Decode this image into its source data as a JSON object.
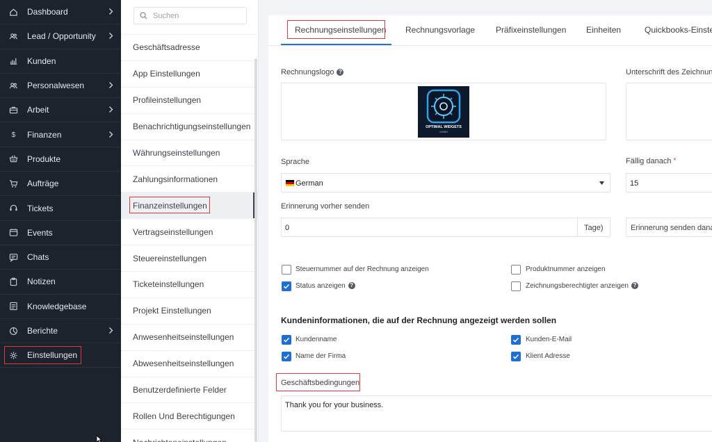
{
  "sidebar": {
    "items": [
      {
        "label": "Dashboard",
        "icon": "home-icon",
        "chevron": true
      },
      {
        "label": "Lead / Opportunity",
        "icon": "users-icon",
        "chevron": true
      },
      {
        "label": "Kunden",
        "icon": "chart-icon",
        "chevron": false
      },
      {
        "label": "Personalwesen",
        "icon": "people-icon",
        "chevron": true
      },
      {
        "label": "Arbeit",
        "icon": "briefcase-icon",
        "chevron": true
      },
      {
        "label": "Finanzen",
        "icon": "dollar-icon",
        "chevron": true
      },
      {
        "label": "Produkte",
        "icon": "basket-icon",
        "chevron": false
      },
      {
        "label": "Aufträge",
        "icon": "cart-icon",
        "chevron": false
      },
      {
        "label": "Tickets",
        "icon": "headset-icon",
        "chevron": false
      },
      {
        "label": "Events",
        "icon": "calendar-icon",
        "chevron": false
      },
      {
        "label": "Chats",
        "icon": "chat-icon",
        "chevron": false
      },
      {
        "label": "Notizen",
        "icon": "clipboard-icon",
        "chevron": false
      },
      {
        "label": "Knowledgebase",
        "icon": "document-icon",
        "chevron": false
      },
      {
        "label": "Berichte",
        "icon": "pie-icon",
        "chevron": true
      },
      {
        "label": "Einstellungen",
        "icon": "gear-icon",
        "chevron": false
      }
    ]
  },
  "submenu": {
    "search_placeholder": "Suchen",
    "items": [
      "Geschäftsadresse",
      "App Einstellungen",
      "Profileinstellungen",
      "Benachrichtigungseinstellungen",
      "Währungseinstellungen",
      "Zahlungsinformationen",
      "Finanzeinstellungen",
      "Vertragseinstellungen",
      "Steuereinstellungen",
      "Ticketeinstellungen",
      "Projekt Einstellungen",
      "Anwesenheitseinstellungen",
      "Abwesenheitseinstellungen",
      "Benutzerdefinierte Felder",
      "Rollen Und Berechtigungen",
      "Nachrichteneinstellungen"
    ],
    "active_index": 6
  },
  "tabs": [
    "Rechnungseinstellungen",
    "Rechnungsvorlage",
    "Präfixeinstellungen",
    "Einheiten",
    "Quickbooks-Einstell"
  ],
  "form": {
    "logo_label": "Rechnungslogo",
    "signature_label": "Unterschrift des Zeichnung",
    "logo_text": "OPTIMAL WIDGETS",
    "logo_subtext": "GMBH",
    "language_label": "Sprache",
    "language_value": "German",
    "due_label": "Fällig danach",
    "due_required": "*",
    "due_value": "15",
    "reminder_label": "Erinnerung vorher senden",
    "reminder_value": "0",
    "reminder_unit": "Tage)",
    "reminder_after_value": "Erinnerung senden danac",
    "checkboxes": [
      {
        "label": "Steuernummer auf der Rechnung anzeigen",
        "checked": false
      },
      {
        "label": "Produktnummer anzeigen",
        "checked": false
      },
      {
        "label": "Status anzeigen",
        "checked": true
      },
      {
        "label": "Zeichnungsberechtigter anzeigen",
        "checked": false
      }
    ],
    "customer_section_title": "Kundeninformationen, die auf der Rechnung angezeigt werden sollen",
    "customer_checkboxes": [
      {
        "label": "Kundenname",
        "checked": true
      },
      {
        "label": "Kunden-E-Mail",
        "checked": true
      },
      {
        "label": "Name der Firma",
        "checked": true
      },
      {
        "label": "Klient Adresse",
        "checked": true
      }
    ],
    "terms_label": "Geschäftsbedingungen",
    "terms_value": "Thank you for your business."
  },
  "colors": {
    "sidebar_bg": "#1c232d",
    "accent": "#1d6fd6",
    "highlight": "#e0393b"
  }
}
